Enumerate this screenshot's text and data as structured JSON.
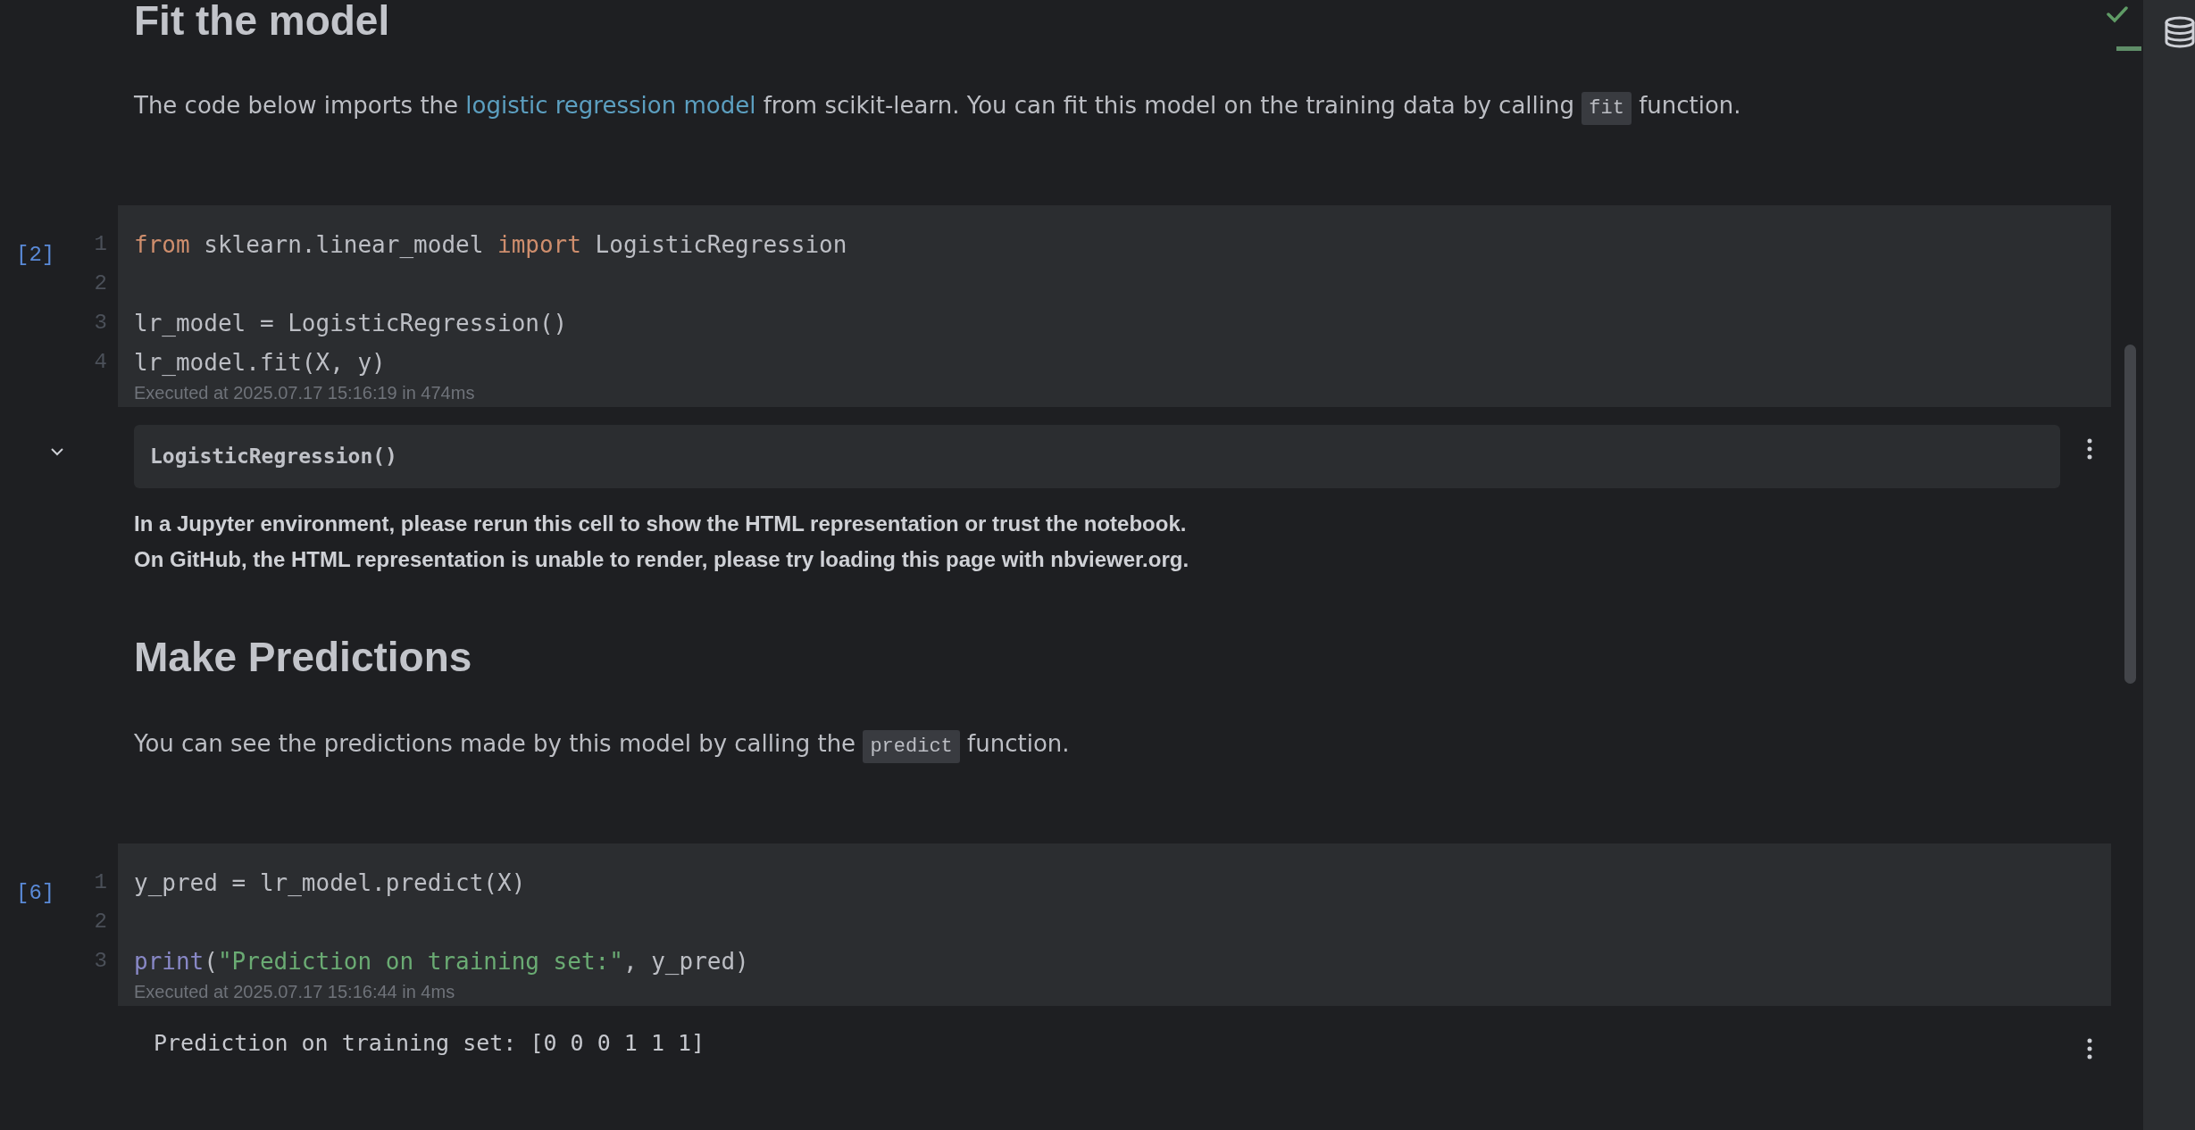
{
  "blocks": [
    {
      "kind": "heading",
      "text": "Fit the model"
    },
    {
      "kind": "paragraph",
      "parts": [
        {
          "kind": "text",
          "text": "The code below imports the "
        },
        {
          "kind": "link",
          "text": "logistic regression model"
        },
        {
          "kind": "text",
          "text": " from scikit-learn. You can fit this model on the training data by calling "
        },
        {
          "kind": "code",
          "text": "fit"
        },
        {
          "kind": "text",
          "text": " function."
        }
      ]
    },
    {
      "kind": "code_cell",
      "count": "[2]",
      "status": "Executed at 2025.07.17 15:16:19 in 474ms",
      "lines": [
        {
          "number": "1",
          "tokens": [
            {
              "kind": "keyword",
              "text": "from"
            },
            {
              "kind": "plain",
              "text": " sklearn.linear_model "
            },
            {
              "kind": "keyword",
              "text": "import"
            },
            {
              "kind": "plain",
              "text": " LogisticRegression"
            }
          ]
        },
        {
          "number": "2"
        },
        {
          "number": "3",
          "tokens": [
            {
              "kind": "plain",
              "text": "lr_model = LogisticRegression()"
            }
          ]
        },
        {
          "number": "4",
          "tokens": [
            {
              "kind": "plain",
              "text": "lr_model.fit(X, y)"
            }
          ]
        }
      ]
    },
    {
      "kind": "output",
      "expanded": true,
      "boxed": "LogisticRegression()",
      "notes": [
        "In a Jupyter environment, please rerun this cell to show the HTML representation or trust the notebook.",
        "On GitHub, the HTML representation is unable to render, please try loading this page with nbviewer.org."
      ]
    },
    {
      "kind": "heading",
      "text": "Make Predictions"
    },
    {
      "kind": "paragraph",
      "parts": [
        {
          "kind": "text",
          "text": "You can see the predictions made by this model by calling the "
        },
        {
          "kind": "code",
          "text": "predict"
        },
        {
          "kind": "text",
          "text": " function."
        }
      ]
    },
    {
      "kind": "code_cell",
      "count": "[6]",
      "status": "Executed at 2025.07.17 15:16:44 in 4ms",
      "lines": [
        {
          "number": "1",
          "tokens": [
            {
              "kind": "plain",
              "text": "y_pred = lr_model.predict(X)"
            }
          ]
        },
        {
          "number": "2"
        },
        {
          "number": "3",
          "tokens": [
            {
              "kind": "builtin",
              "text": "print"
            },
            {
              "kind": "plain",
              "text": "("
            },
            {
              "kind": "string",
              "text": "\"Prediction on training set:\""
            },
            {
              "kind": "plain",
              "text": ", y_pred)"
            }
          ]
        }
      ]
    },
    {
      "kind": "stream",
      "text": "Prediction on training set: [0 0 0 1 1 1]"
    }
  ]
}
